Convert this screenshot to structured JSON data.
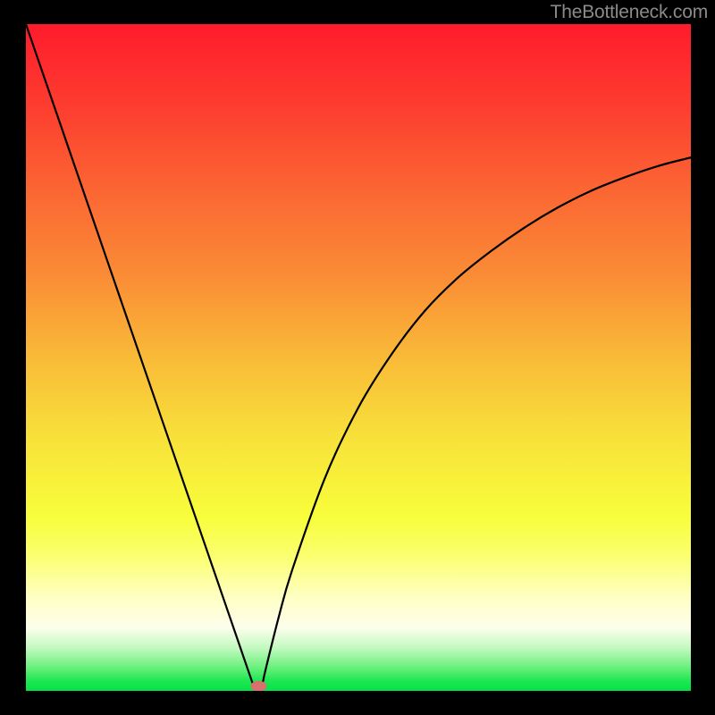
{
  "watermark": "TheBottleneck.com",
  "chart_data": {
    "type": "line",
    "title": "",
    "xlabel": "",
    "ylabel": "",
    "xlim": [
      0,
      100
    ],
    "ylim": [
      0,
      100
    ],
    "grid": false,
    "x": [
      0,
      5,
      10,
      15,
      20,
      25,
      30,
      32,
      34,
      34.5,
      35,
      35.5,
      36,
      38,
      40,
      45,
      50,
      55,
      60,
      65,
      70,
      75,
      80,
      85,
      90,
      95,
      100
    ],
    "values": [
      100,
      85.5,
      71,
      56.5,
      42,
      27.5,
      13,
      7.2,
      1.4,
      0.2,
      0,
      0.7,
      3.0,
      11.0,
      18.0,
      32.0,
      42.5,
      50.5,
      57.0,
      62.0,
      66.0,
      69.5,
      72.5,
      75.0,
      77.0,
      78.7,
      80.0
    ],
    "marker": {
      "x": 35,
      "y": 0.7,
      "rx": 1.2,
      "ry": 0.8,
      "color": "#d6716d"
    },
    "gradient_stops": [
      {
        "offset": 0.0,
        "color": "#fe1b2c"
      },
      {
        "offset": 0.12,
        "color": "#fd3c2f"
      },
      {
        "offset": 0.25,
        "color": "#fb6633"
      },
      {
        "offset": 0.38,
        "color": "#fa8d36"
      },
      {
        "offset": 0.5,
        "color": "#f9ba38"
      },
      {
        "offset": 0.62,
        "color": "#f8e13a"
      },
      {
        "offset": 0.74,
        "color": "#f8fe3b"
      },
      {
        "offset": 0.8,
        "color": "#fbff72"
      },
      {
        "offset": 0.86,
        "color": "#feffc3"
      },
      {
        "offset": 0.905,
        "color": "#fdfeec"
      },
      {
        "offset": 0.935,
        "color": "#c4fac1"
      },
      {
        "offset": 0.965,
        "color": "#6bf07c"
      },
      {
        "offset": 0.985,
        "color": "#1de751"
      },
      {
        "offset": 1.0,
        "color": "#05e247"
      }
    ]
  },
  "colors": {
    "frame_bg": "#000000",
    "curve": "#000000"
  }
}
